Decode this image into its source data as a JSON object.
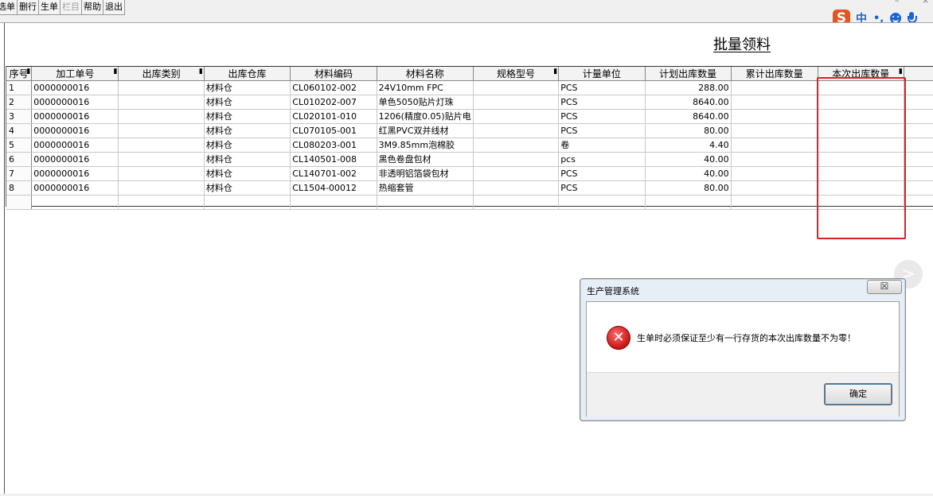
{
  "toolbar": {
    "buttons": [
      "选单",
      "删行",
      "生单",
      "栏目",
      "帮助",
      "退出"
    ]
  },
  "window_controls": {
    "minimize": "–",
    "close": "×"
  },
  "ime": {
    "logo": "S",
    "lang": "中",
    "punct": "•,",
    "emoji": "smile-icon",
    "mic": "microphone-icon"
  },
  "page": {
    "title": "批量领料"
  },
  "grid": {
    "columns": [
      "序号",
      "加工单号",
      "出库类别",
      "出库仓库",
      "材料编码",
      "材料名称",
      "规格型号",
      "计量单位",
      "计划出库数量",
      "累计出库数量",
      "本次出库数量"
    ],
    "rows": [
      [
        "1",
        "0000000016",
        "",
        "材料仓",
        "CL060102-002",
        "24V10mm FPC",
        "",
        "PCS",
        "288.00",
        "",
        ""
      ],
      [
        "2",
        "0000000016",
        "",
        "材料仓",
        "CL010202-007",
        "单色5050贴片灯珠",
        "",
        "PCS",
        "8640.00",
        "",
        ""
      ],
      [
        "3",
        "0000000016",
        "",
        "材料仓",
        "CL020101-010",
        "1206(精度0.05)贴片电",
        "",
        "PCS",
        "8640.00",
        "",
        ""
      ],
      [
        "4",
        "0000000016",
        "",
        "材料仓",
        "CL070105-001",
        "红黑PVC双并线材",
        "",
        "PCS",
        "80.00",
        "",
        ""
      ],
      [
        "5",
        "0000000016",
        "",
        "材料仓",
        "CL080203-001",
        "3M9.85mm泡棉胶",
        "",
        "卷",
        "4.40",
        "",
        ""
      ],
      [
        "6",
        "0000000016",
        "",
        "材料仓",
        "CL140501-008",
        "黑色卷盘包材",
        "",
        "pcs",
        "40.00",
        "",
        ""
      ],
      [
        "7",
        "0000000016",
        "",
        "材料仓",
        "CL140701-002",
        "非透明铝箔袋包材",
        "",
        "PCS",
        "40.00",
        "",
        ""
      ],
      [
        "8",
        "0000000016",
        "",
        "材料仓",
        "CL1504-00012",
        "热缩套管",
        "",
        "PCS",
        "80.00",
        "",
        ""
      ]
    ]
  },
  "dialog": {
    "title": "生产管理系统",
    "close_label": "☒",
    "message": "生单时必须保证至少有一行存货的本次出库数量不为零！",
    "ok_label": "确定"
  },
  "colors": {
    "highlight": "#e02020",
    "ime_brand": "#e8531c",
    "ime_blue": "#1c63d6"
  }
}
